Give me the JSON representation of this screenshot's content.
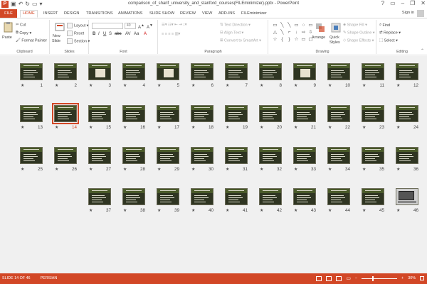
{
  "app": {
    "title": "comparison_of_sharif_university_and_stanford_courses(FILEminimizer).pptx - PowerPoint",
    "logo": "P",
    "sign_in": "Sign in",
    "window_controls": [
      "?",
      "▭",
      "–",
      "❐",
      "✕"
    ]
  },
  "tabs": [
    "FILE",
    "HOME",
    "INSERT",
    "DESIGN",
    "TRANSITIONS",
    "ANIMATIONS",
    "SLIDE SHOW",
    "REVIEW",
    "VIEW",
    "ADD-INS",
    "FILEminimizer"
  ],
  "active_tab": "HOME",
  "ribbon": {
    "clipboard": {
      "paste": "Paste",
      "cut": "Cut",
      "copy": "Copy",
      "format_painter": "Format Painter",
      "label": "Clipboard"
    },
    "slides": {
      "new_slide": "New",
      "new_slide2": "Slide",
      "layout": "Layout",
      "reset": "Reset",
      "section": "Section",
      "label": "Slides"
    },
    "font": {
      "font_size": "40",
      "label": "Font",
      "buttons": [
        "B",
        "I",
        "U",
        "S",
        "abc",
        "AV",
        "Aa",
        "A"
      ]
    },
    "paragraph": {
      "text_direction": "Text Direction",
      "align_text": "Align Text",
      "convert_smartart": "Convert to SmartArt",
      "label": "Paragraph"
    },
    "drawing": {
      "arrange": "Arrange",
      "quick_styles": "Quick",
      "quick_styles2": "Styles",
      "shape_fill": "Shape Fill",
      "shape_outline": "Shape Outline",
      "shape_effects": "Shape Effects",
      "label": "Drawing",
      "shapes": [
        "▭",
        "╲",
        "╲",
        "▭",
        "○",
        "▭",
        "△",
        "╲",
        "⌐",
        "↓",
        "⇨",
        "⇩",
        "☆",
        "{",
        "}",
        "☆",
        "▭",
        "▢"
      ]
    },
    "editing": {
      "find": "Find",
      "replace": "Replace",
      "select": "Select",
      "label": "Editing"
    }
  },
  "slides": [
    {
      "n": "12",
      "kind": "text"
    },
    {
      "n": "11",
      "kind": "text"
    },
    {
      "n": "10",
      "kind": "text"
    },
    {
      "n": "9",
      "kind": "image"
    },
    {
      "n": "8",
      "kind": "text"
    },
    {
      "n": "7",
      "kind": "text"
    },
    {
      "n": "6",
      "kind": "text"
    },
    {
      "n": "5",
      "kind": "image"
    },
    {
      "n": "4",
      "kind": "text"
    },
    {
      "n": "3",
      "kind": "image"
    },
    {
      "n": "2",
      "kind": "text"
    },
    {
      "n": "1",
      "kind": "text"
    },
    {
      "n": "24",
      "kind": "text"
    },
    {
      "n": "23",
      "kind": "text"
    },
    {
      "n": "22",
      "kind": "text"
    },
    {
      "n": "21",
      "kind": "text"
    },
    {
      "n": "20",
      "kind": "text"
    },
    {
      "n": "19",
      "kind": "text"
    },
    {
      "n": "18",
      "kind": "text"
    },
    {
      "n": "17",
      "kind": "text"
    },
    {
      "n": "16",
      "kind": "text"
    },
    {
      "n": "15",
      "kind": "text"
    },
    {
      "n": "14",
      "kind": "text"
    },
    {
      "n": "13",
      "kind": "text"
    },
    {
      "n": "36",
      "kind": "text"
    },
    {
      "n": "35",
      "kind": "text"
    },
    {
      "n": "34",
      "kind": "text"
    },
    {
      "n": "33",
      "kind": "text"
    },
    {
      "n": "32",
      "kind": "text"
    },
    {
      "n": "31",
      "kind": "text"
    },
    {
      "n": "30",
      "kind": "text"
    },
    {
      "n": "29",
      "kind": "text"
    },
    {
      "n": "28",
      "kind": "text"
    },
    {
      "n": "27",
      "kind": "text"
    },
    {
      "n": "26",
      "kind": "text"
    },
    {
      "n": "25",
      "kind": "text"
    },
    {
      "n": "46",
      "kind": "photo"
    },
    {
      "n": "45",
      "kind": "text"
    },
    {
      "n": "44",
      "kind": "text"
    },
    {
      "n": "43",
      "kind": "text"
    },
    {
      "n": "42",
      "kind": "text"
    },
    {
      "n": "41",
      "kind": "text"
    },
    {
      "n": "40",
      "kind": "text"
    },
    {
      "n": "39",
      "kind": "text"
    },
    {
      "n": "38",
      "kind": "text"
    },
    {
      "n": "37",
      "kind": "text"
    }
  ],
  "selected_slide": "14",
  "status": {
    "slide_info": "SLIDE 14 OF 46",
    "language": "PERSIAN",
    "zoom": "30%",
    "zoom_fraction": 0.3
  },
  "colors": {
    "accent": "#d24726"
  }
}
